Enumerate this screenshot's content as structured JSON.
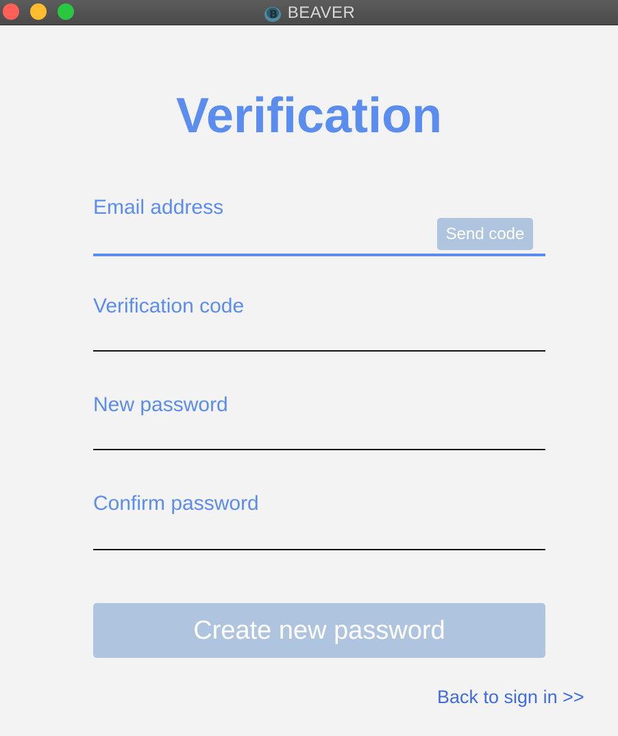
{
  "window": {
    "title": "BEAVER",
    "logo_icon": "beaver-logo-icon"
  },
  "page": {
    "heading": "Verification"
  },
  "form": {
    "email_label": "Email address",
    "email_value": "",
    "send_code_label": "Send code",
    "code_label": "Verification code",
    "code_value": "",
    "new_password_label": "New password",
    "new_password_value": "",
    "confirm_password_label": "Confirm password",
    "confirm_password_value": "",
    "submit_label": "Create new password",
    "back_link": "Back to sign in >>"
  },
  "colors": {
    "accent": "#5b8def",
    "button_disabled": "#aec4df",
    "link": "#3f6ce0",
    "background": "#f3f3f3"
  }
}
